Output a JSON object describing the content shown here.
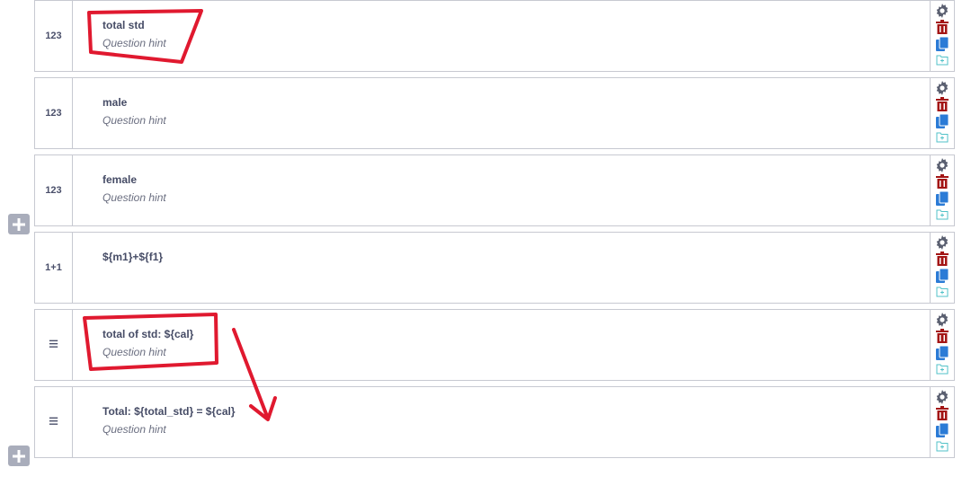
{
  "questions": [
    {
      "type_badge": "123",
      "label": "total std",
      "hint": "Question hint"
    },
    {
      "type_badge": "123",
      "label": "male",
      "hint": "Question hint"
    },
    {
      "type_badge": "123",
      "label": "female",
      "hint": "Question hint"
    },
    {
      "type_badge": "1+1",
      "label": "${m1}+${f1}",
      "hint": ""
    },
    {
      "type_badge": "≡",
      "label": "total of std: ${cal}",
      "hint": "Question hint"
    },
    {
      "type_badge": "≡",
      "label": "Total: ${total_std} = ${cal}",
      "hint": "Question hint"
    }
  ],
  "row_actions": [
    "settings-icon",
    "delete-icon",
    "duplicate-icon",
    "add-to-library-icon"
  ],
  "colors": {
    "settings": "#5a5f70",
    "delete": "#a31515",
    "duplicate": "#2b7bd6",
    "library": "#52c2c8",
    "annotation": "#e0192f",
    "add_button": "#a9adbb"
  }
}
